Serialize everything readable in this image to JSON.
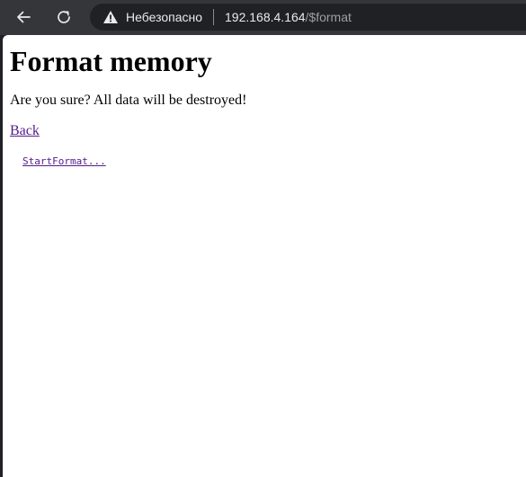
{
  "browser": {
    "back_icon": "arrow-left-icon",
    "reload_icon": "reload-icon",
    "security_icon": "warning-triangle-icon",
    "security_label": "Небезопасно",
    "url_host": "192.168.4.164",
    "url_path": "/$format"
  },
  "page": {
    "title": "Format memory",
    "warning": "Are you sure? All data will be destroyed!",
    "back_link": "Back",
    "start_link": "StartFormat..."
  },
  "colors": {
    "toolbar_bg": "#35363a",
    "omnibox_bg": "#202124",
    "visited_link": "#551a8b",
    "page_bg": "#ffffff"
  }
}
